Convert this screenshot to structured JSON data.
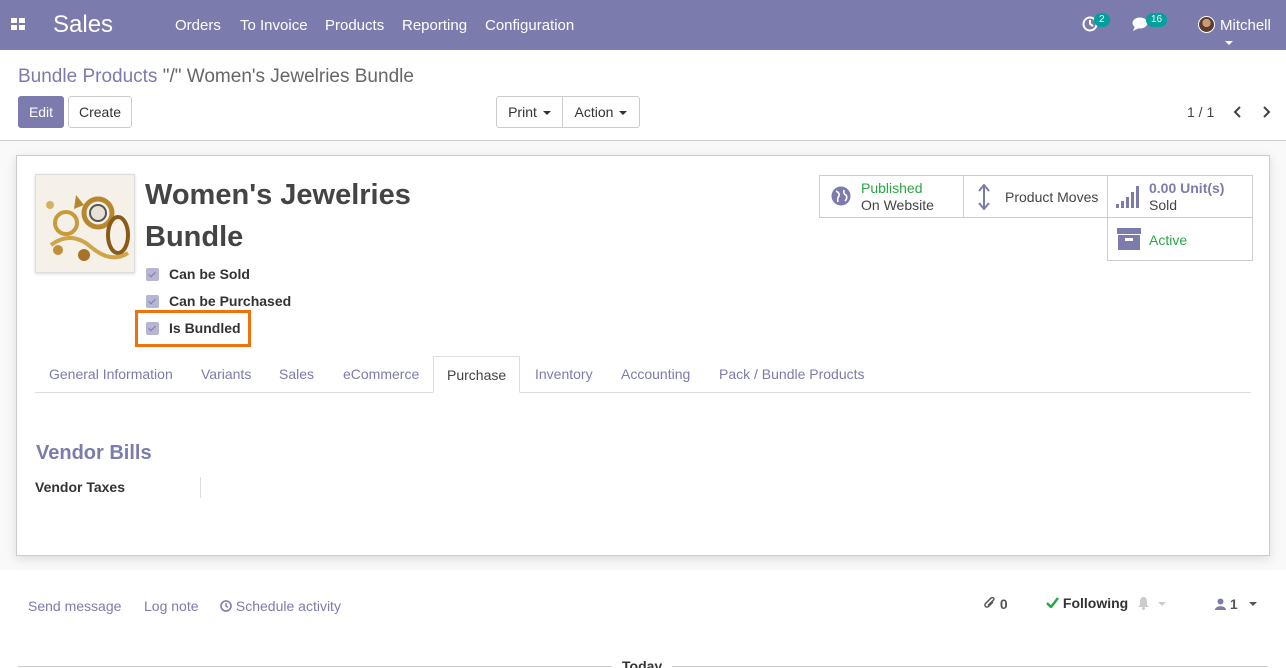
{
  "navbar": {
    "brand": "Sales",
    "menu": [
      "Orders",
      "To Invoice",
      "Products",
      "Reporting",
      "Configuration"
    ],
    "activity_count": "2",
    "message_count": "16",
    "user_name": "Mitchell"
  },
  "breadcrumb": {
    "parent": "Bundle Products",
    "separator": "\"/\"",
    "current": "Women's Jewelries Bundle"
  },
  "toolbar": {
    "edit_label": "Edit",
    "create_label": "Create",
    "print_label": "Print",
    "action_label": "Action"
  },
  "pager": {
    "value": "1 / 1"
  },
  "product": {
    "name_line1": "Women's Jewelries",
    "name_line2": "Bundle",
    "checkboxes": [
      {
        "label": "Can be Sold",
        "checked": true
      },
      {
        "label": "Can be Purchased",
        "checked": true
      },
      {
        "label": "Is Bundled",
        "checked": true
      }
    ]
  },
  "stat_buttons": {
    "published_line1": "Published",
    "published_line2": "On Website",
    "moves_label": "Product Moves",
    "sold_value": "0.00 Unit(s)",
    "sold_label": "Sold",
    "active_label": "Active"
  },
  "tabs": [
    "General Information",
    "Variants",
    "Sales",
    "eCommerce",
    "Purchase",
    "Inventory",
    "Accounting",
    "Pack / Bundle Products"
  ],
  "active_tab": "Purchase",
  "purchase_tab": {
    "section_title": "Vendor Bills",
    "vendor_taxes_label": "Vendor Taxes"
  },
  "chatter": {
    "send_message": "Send message",
    "log_note": "Log note",
    "schedule_activity": "Schedule activity",
    "attachments_count": "0",
    "following_label": "Following",
    "followers_count": "1",
    "today_label": "Today"
  },
  "colors": {
    "brand": "#7c7bad",
    "highlight": "#f0720c",
    "success": "#28a745",
    "badge": "#00a09d"
  }
}
